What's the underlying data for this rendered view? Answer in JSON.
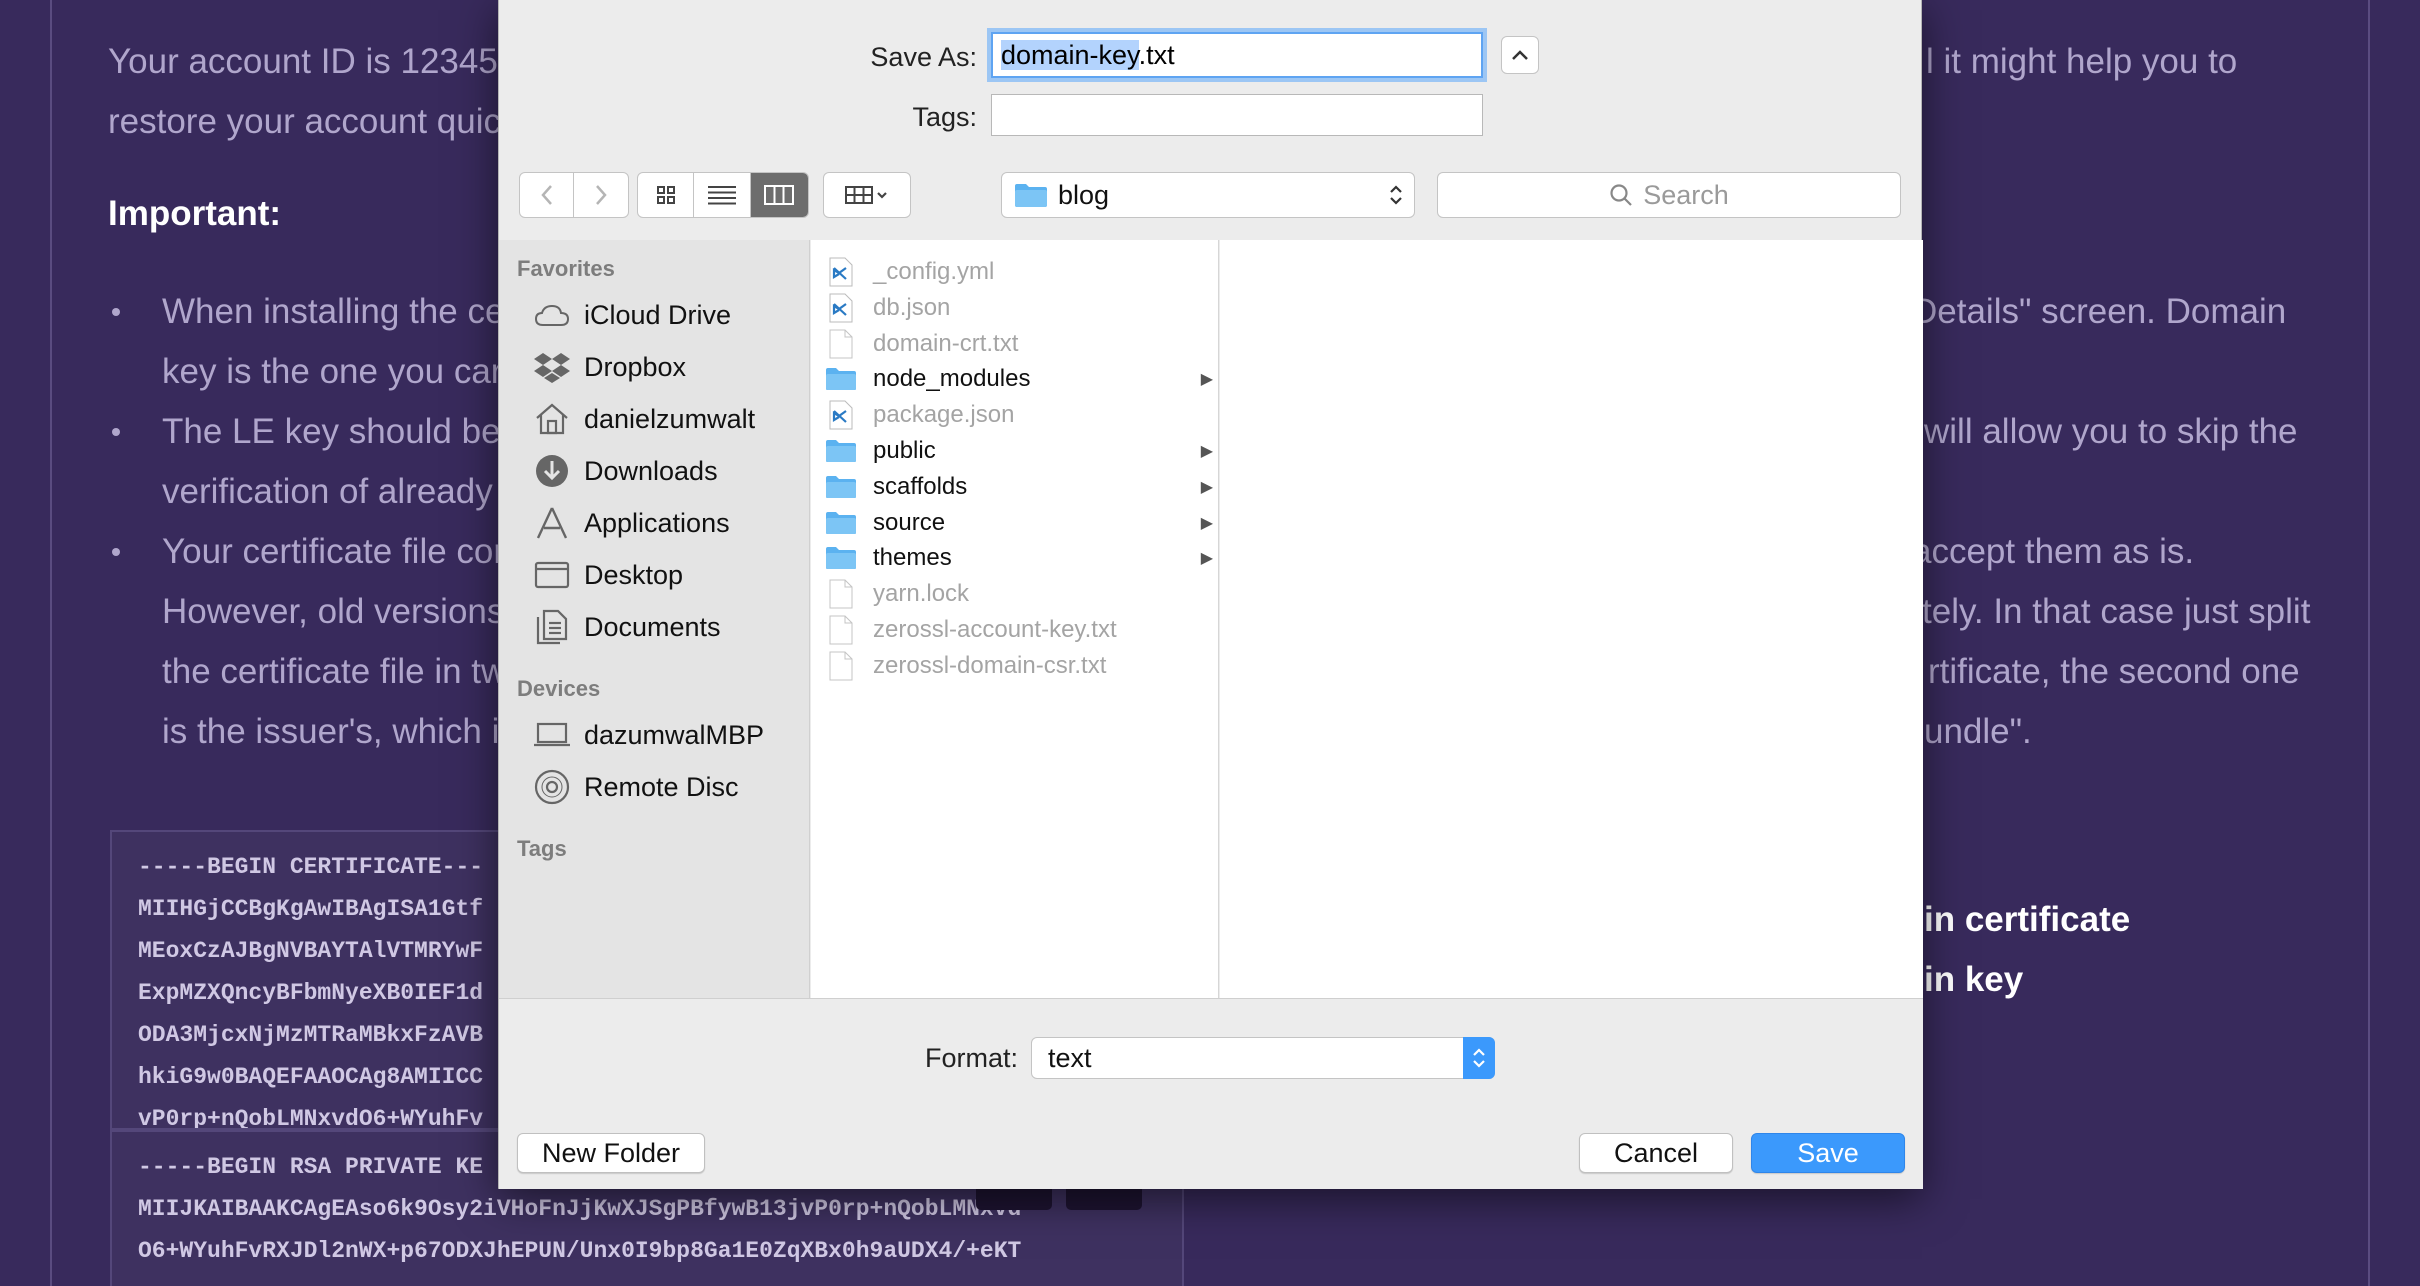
{
  "background": {
    "lines": [
      {
        "text": "Your account ID is 12345",
        "cls": "bgtext"
      },
      {
        "text": "restore your account quic"
      },
      {
        "text": "l it might help you to"
      }
    ],
    "intro_line1": "Your account ID is 12345",
    "intro_line2": "restore your account quic",
    "intro_right": "l it might help you to",
    "important": "Important:",
    "b1_l1": "When installing the ce",
    "b1_l1_right": "Details\" screen. Domain",
    "b1_l2": "key is the one you car",
    "b2_l1": "The LE key should be",
    "b2_l1_right": "will allow you to skip the",
    "b2_l2": "verification of already",
    "b3_l1": "Your certificate file cor",
    "b3_l1_right": "accept them as is.",
    "b3_l2": "However, old versions",
    "b3_l2_right": "tely. In that case just split",
    "b3_l3": "the certificate file in tw",
    "b3_l3_right": "rtificate, the second one",
    "b3_l4": "is the issuer's, which i",
    "b3_l4_right": "undle\".",
    "cert_lines": [
      "-----BEGIN CERTIFICATE---",
      "MIIHGjCCBgKgAwIBAgISA1Gtf",
      "MEoxCzAJBgNVBAYTAlVTMRYwF",
      "ExpMZXQncyBFbmNyeXB0IEF1d",
      "ODA3MjcxNjMzMTRaMBkxFzAVB",
      "hkiG9w0BAQEFAAOCAg8AMIICC",
      "vP0rp+nQobLMNxvdO6+WYuhFv"
    ],
    "key_lines": [
      "-----BEGIN RSA PRIVATE KE",
      "MIIJKAIBAAKCAgEAso6k9Osy2iVHoFnJjKwXJSgPBfywB13jvP0rp+nQobLMNxvd",
      "O6+WYuhFvRXJDl2nWX+p67ODXJhEPUN/Unx0I9bp8Ga1E0ZqXBx0h9aUDX4/+eKT"
    ],
    "right_label1": "in certificate",
    "right_label2": "in key"
  },
  "dialog": {
    "save_as_label": "Save As:",
    "filename_selected": "domain-key",
    "filename_ext": ".txt",
    "tags_label": "Tags:",
    "tags_value": "",
    "location": "blog",
    "search_placeholder": "Search",
    "sidebar": {
      "favorites_header": "Favorites",
      "favorites": [
        {
          "label": "iCloud Drive",
          "icon": "cloud-icon"
        },
        {
          "label": "Dropbox",
          "icon": "dropbox-icon"
        },
        {
          "label": "danielzumwalt",
          "icon": "home-icon"
        },
        {
          "label": "Downloads",
          "icon": "download-icon"
        },
        {
          "label": "Applications",
          "icon": "applications-icon"
        },
        {
          "label": "Desktop",
          "icon": "desktop-icon"
        },
        {
          "label": "Documents",
          "icon": "document-icon"
        }
      ],
      "devices_header": "Devices",
      "devices": [
        {
          "label": "dazumwalMBP",
          "icon": "laptop-icon"
        },
        {
          "label": "Remote Disc",
          "icon": "disc-icon"
        }
      ],
      "tags_header": "Tags"
    },
    "files": [
      {
        "name": "_config.yml",
        "type": "vscode",
        "enabled": false,
        "folder": false
      },
      {
        "name": "db.json",
        "type": "vscode",
        "enabled": false,
        "folder": false
      },
      {
        "name": "domain-crt.txt",
        "type": "doc",
        "enabled": false,
        "folder": false
      },
      {
        "name": "node_modules",
        "type": "folder",
        "enabled": true,
        "folder": true
      },
      {
        "name": "package.json",
        "type": "vscode",
        "enabled": false,
        "folder": false
      },
      {
        "name": "public",
        "type": "folder",
        "enabled": true,
        "folder": true
      },
      {
        "name": "scaffolds",
        "type": "folder",
        "enabled": true,
        "folder": true
      },
      {
        "name": "source",
        "type": "folder",
        "enabled": true,
        "folder": true
      },
      {
        "name": "themes",
        "type": "folder",
        "enabled": true,
        "folder": true
      },
      {
        "name": "yarn.lock",
        "type": "doc",
        "enabled": false,
        "folder": false
      },
      {
        "name": "zerossl-account-key.txt",
        "type": "doc",
        "enabled": false,
        "folder": false
      },
      {
        "name": "zerossl-domain-csr.txt",
        "type": "doc",
        "enabled": false,
        "folder": false
      }
    ],
    "format_label": "Format:",
    "format_value": "text",
    "new_folder_label": "New Folder",
    "cancel_label": "Cancel",
    "save_label": "Save"
  },
  "colors": {
    "accent": "#3b99fc",
    "folder": "#5bb2f0",
    "background": "#382a5c"
  }
}
